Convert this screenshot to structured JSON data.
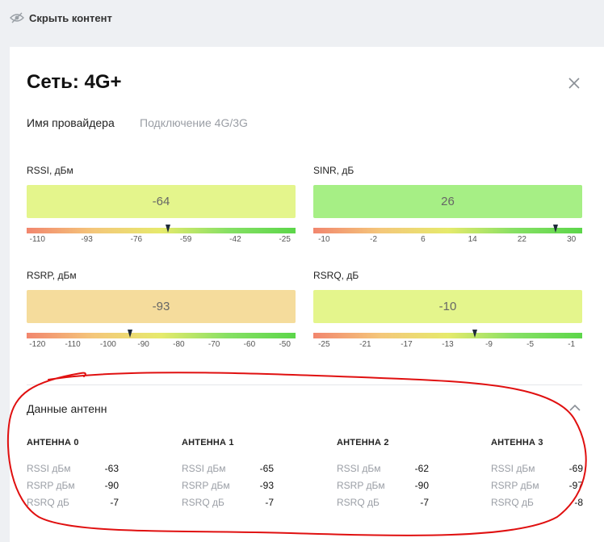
{
  "topbar": {
    "hide_label": "Скрыть контент",
    "icon": "eye-slash-icon"
  },
  "dialog": {
    "title": "Сеть: 4G+",
    "close_icon": "close-icon",
    "tabs": [
      {
        "label": "Имя провайдера",
        "active": true
      },
      {
        "label": "Подключение 4G/3G",
        "active": false
      }
    ]
  },
  "metrics": {
    "rssi": {
      "label": "RSSI, дБм",
      "value": "-64",
      "box_color": "#e4f58c",
      "ticks": [
        "-110",
        "-93",
        "-76",
        "-59",
        "-42",
        "-25"
      ],
      "marker_fraction": 0.525
    },
    "sinr": {
      "label": "SINR, дБ",
      "value": "26",
      "box_color": "#a6ef85",
      "ticks": [
        "-10",
        "-2",
        "6",
        "14",
        "22",
        "30"
      ],
      "marker_fraction": 0.9
    },
    "rsrp": {
      "label": "RSRP, дБм",
      "value": "-93",
      "box_color": "#f5dc9c",
      "ticks": [
        "-120",
        "-110",
        "-100",
        "-90",
        "-80",
        "-70",
        "-60",
        "-50"
      ],
      "marker_fraction": 0.385
    },
    "rsrq": {
      "label": "RSRQ, дБ",
      "value": "-10",
      "box_color": "#e4f58c",
      "ticks": [
        "-25",
        "-21",
        "-17",
        "-13",
        "-9",
        "-5",
        "-1"
      ],
      "marker_fraction": 0.6
    }
  },
  "bar_gradient": [
    "#f2866e",
    "#f4c77a",
    "#e6ea6c",
    "#86e064",
    "#5cd64a"
  ],
  "antennas": {
    "title": "Данные антенн",
    "chevron_icon": "chevron-up-icon",
    "items": [
      {
        "name": "АНТЕННА 0",
        "rssi_label": "RSSI дБм",
        "rssi": "-63",
        "rsrp_label": "RSRP дБм",
        "rsrp": "-90",
        "rsrq_label": "RSRQ дБ",
        "rsrq": "-7"
      },
      {
        "name": "АНТЕННА 1",
        "rssi_label": "RSSI дБм",
        "rssi": "-65",
        "rsrp_label": "RSRP дБм",
        "rsrp": "-93",
        "rsrq_label": "RSRQ дБ",
        "rsrq": "-7"
      },
      {
        "name": "АНТЕННА 2",
        "rssi_label": "RSSI дБм",
        "rssi": "-62",
        "rsrp_label": "RSRP дБм",
        "rsrp": "-90",
        "rsrq_label": "RSRQ дБ",
        "rsrq": "-7"
      },
      {
        "name": "АНТЕННА 3",
        "rssi_label": "RSSI дБм",
        "rssi": "-69",
        "rsrp_label": "RSRP дБм",
        "rsrp": "-97",
        "rsrq_label": "RSRQ дБ",
        "rsrq": "-8"
      }
    ]
  },
  "annotation_color": "#e01010"
}
